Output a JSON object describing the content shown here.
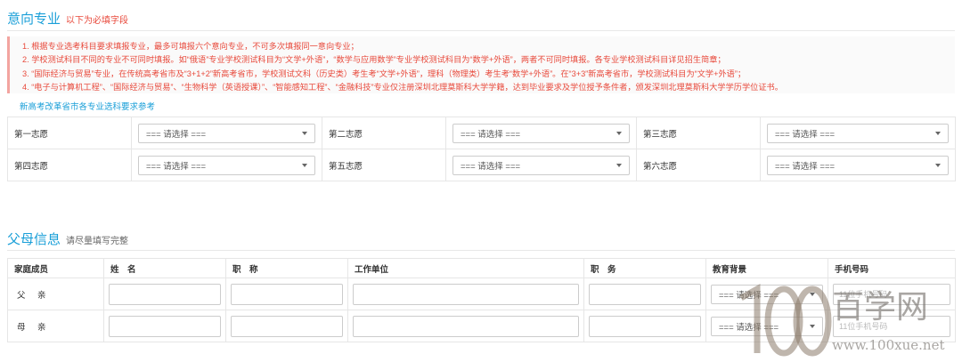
{
  "intent": {
    "title": "意向专业",
    "subtitle": "以下为必填字段",
    "notices": [
      "1. 根据专业选考科目要求填报专业，最多可填报六个意向专业，不可多次填报同一意向专业；",
      "2. 学校测试科目不同的专业不可同时填报。如“俄语”专业学校测试科目为“文学+外语”，“数学与应用数学”专业学校测试科目为“数学+外语”，两者不可同时填报。各专业学校测试科目详见招生简章；",
      "3. “国际经济与贸易”专业，在传统高考省市及“3+1+2”新高考省市，学校测试文科（历史类）考生考“文学+外语”，理科（物理类）考生考“数学+外语”。在“3+3”新高考省市，学校测试科目为“文学+外语”；",
      "4. “电子与计算机工程”、“国际经济与贸易”、“生物科学（英语授课）”、“智能感知工程”、“金融科技”专业仅注册深圳北理莫斯科大学学籍，达到毕业要求及学位授予条件者，颁发深圳北理莫斯科大学学历学位证书。"
    ],
    "ref_link": "新高考改革省市各专业选科要求参考",
    "rows": [
      [
        {
          "label": "第一志愿",
          "value": "=== 请选择 ==="
        },
        {
          "label": "第二志愿",
          "value": "=== 请选择 ==="
        },
        {
          "label": "第三志愿",
          "value": "=== 请选择 ==="
        }
      ],
      [
        {
          "label": "第四志愿",
          "value": "=== 请选择 ==="
        },
        {
          "label": "第五志愿",
          "value": "=== 请选择 ==="
        },
        {
          "label": "第六志愿",
          "value": "=== 请选择 ==="
        }
      ]
    ]
  },
  "parents": {
    "title": "父母信息",
    "subtitle": "请尽量填写完整",
    "headers": [
      "家庭成员",
      "姓　名",
      "职　称",
      "工作单位",
      "职　务",
      "教育背景",
      "手机号码"
    ],
    "rows": [
      {
        "member": "父　亲",
        "edu": "=== 请选择 ===",
        "phone_placeholder": "11位手机号码"
      },
      {
        "member": "母　亲",
        "edu": "=== 请选择 ===",
        "phone_placeholder": "11位手机号码"
      }
    ]
  },
  "watermark": {
    "text": "百学网",
    "url": "www.100xue.net",
    "logo": "100"
  },
  "colors": {
    "accent": "#1a9fd8",
    "red": "#e84a3c"
  }
}
